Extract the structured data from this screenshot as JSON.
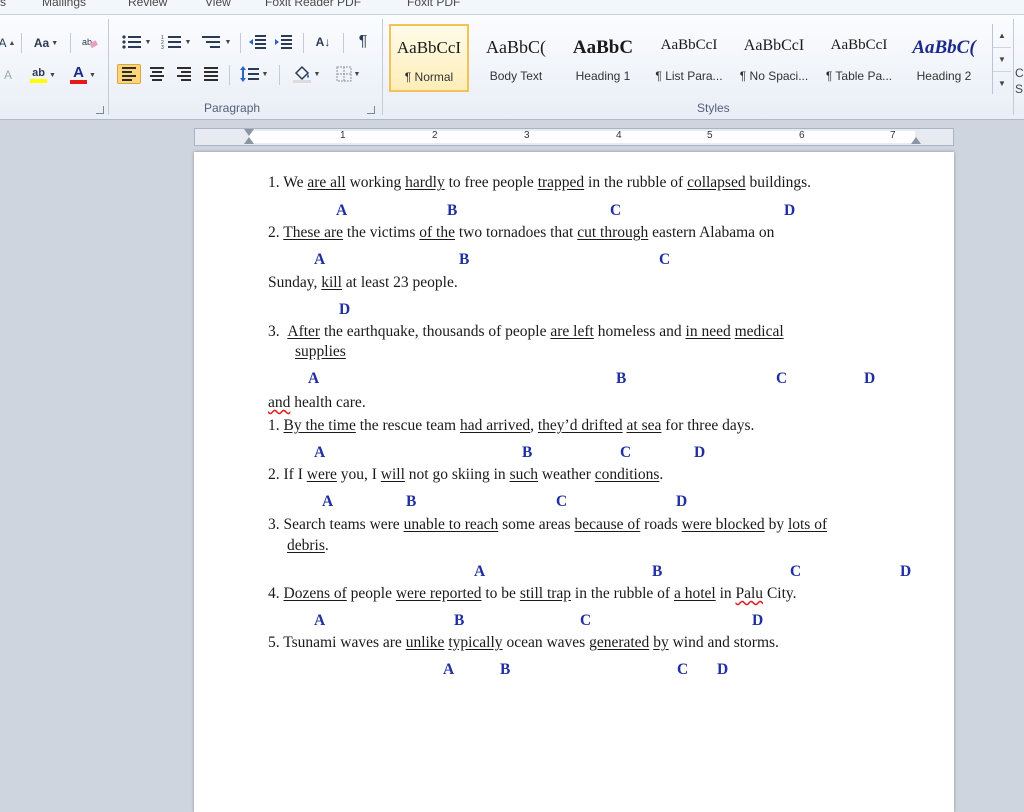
{
  "menu": [
    "s",
    "Mailings",
    "Review",
    "View",
    "Foxit Reader PDF",
    "Foxit PDF"
  ],
  "ribbon": {
    "font_group": {
      "change_case": "Aa",
      "highlight": "ab",
      "font_color": "A",
      "grow_font": "A"
    },
    "paragraph_group_label": "Paragraph",
    "styles_group_label": "Styles",
    "styles": [
      {
        "preview": "AaBbCcI",
        "name": "¶ Normal",
        "selected": true
      },
      {
        "preview": "AaBbC(",
        "name": "Body Text",
        "selected": false
      },
      {
        "preview": "AaBbC",
        "name": "Heading 1",
        "selected": false
      },
      {
        "preview": "AaBbCcI",
        "name": "¶ List Para...",
        "selected": false
      },
      {
        "preview": "AaBbCcI",
        "name": "¶ No Spaci...",
        "selected": false
      },
      {
        "preview": "AaBbCcI",
        "name": "¶ Table Pa...",
        "selected": false
      },
      {
        "preview": "AaBbC(",
        "name": "Heading 2",
        "selected": false
      }
    ],
    "right_edge": "C S",
    "sort_glyph": "A↓",
    "pilcrow_glyph": "¶"
  },
  "ruler": {
    "numbers": [
      "1",
      "2",
      "3",
      "4",
      "5",
      "6",
      "7"
    ]
  },
  "colors": {
    "answer_letters": "#1f2fa0",
    "selected_style": "#fbd679"
  },
  "document": {
    "q1": {
      "num": "1.",
      "p1": "We ",
      "u1": "are all",
      "p2": " working ",
      "u2": "hardly",
      "p3": " to free people ",
      "u3": "trapped",
      "p4": " in the rubble of ",
      "u4": "collapsed",
      "p5": " buildings."
    },
    "q1_letters": [
      "A",
      "B",
      "C",
      "D"
    ],
    "q2": {
      "num": "2.",
      "u1": "These are",
      "p1": " the victims ",
      "u2": "of the",
      "p2": " two tornadoes that ",
      "u3": "cut through",
      "p3": " eastern Alabama on"
    },
    "q2_letters": [
      "A",
      "B",
      "C"
    ],
    "q2b": {
      "p1": "Sunday, ",
      "u1": "kill",
      "p2": " at least 23 people."
    },
    "q2b_letters": [
      "D"
    ],
    "q3": {
      "num": "3.",
      "u1": "After",
      "p1": " the earthquake, thousands of people ",
      "u2": "are left",
      "p2": " homeless and ",
      "u3": "in need",
      "p3": " ",
      "u4": "medical"
    },
    "q3_cont": "supplies",
    "q3_letters": [
      "A",
      "B",
      "C",
      "D"
    ],
    "q3b": {
      "s1": "and",
      "p1": " health care."
    },
    "r1": {
      "num": "1.",
      "u1": "By the time",
      "p1": " the rescue team ",
      "u2": "had arrived",
      "p2": ", ",
      "u3": "they’d drifted",
      "p3": " ",
      "u4": "at sea",
      "p4": " for three days."
    },
    "r1_letters": [
      "A",
      "B",
      "C",
      "D"
    ],
    "r2": {
      "num": "2.",
      "p1": "If I ",
      "u1": "were",
      "p2": " you, I ",
      "u2": "will",
      "p3": " not go skiing in ",
      "u3": "such",
      "p4": " weather ",
      "u4": "conditions",
      "p5": "."
    },
    "r2_letters": [
      "A",
      "B",
      "C",
      "D"
    ],
    "r3": {
      "num": "3.",
      "p1": "Search teams were ",
      "u1": "unable to reach",
      "p2": " some areas ",
      "u2": "because of",
      "p3": " roads ",
      "u3": "were blocked",
      "p4": " by ",
      "u4": "lots of"
    },
    "r3_cont": "debris",
    "r3_tail": ".",
    "r3_letters": [
      "A",
      "B",
      "C",
      "D"
    ],
    "r4": {
      "num": "4.",
      "u1": "Dozens of",
      "p1": " people ",
      "u2": "were reported",
      "p2": " to be ",
      "u3": "still trap",
      "p3": " in the rubble of ",
      "u4": "a hotel",
      "p4": " in ",
      "s1": "Palu",
      "p5": " City."
    },
    "r4_letters": [
      "A",
      "B",
      "C",
      "D"
    ],
    "r5": {
      "num": "5.",
      "p1": "Tsunami waves are ",
      "u1": "unlike",
      "p2": " ",
      "u2": "typically",
      "p3": " ocean waves ",
      "u3": "generated",
      "p4": " ",
      "u4": "by",
      "p5": " wind and storms."
    },
    "r5_letters": [
      "A",
      "B",
      "C",
      "D"
    ]
  }
}
